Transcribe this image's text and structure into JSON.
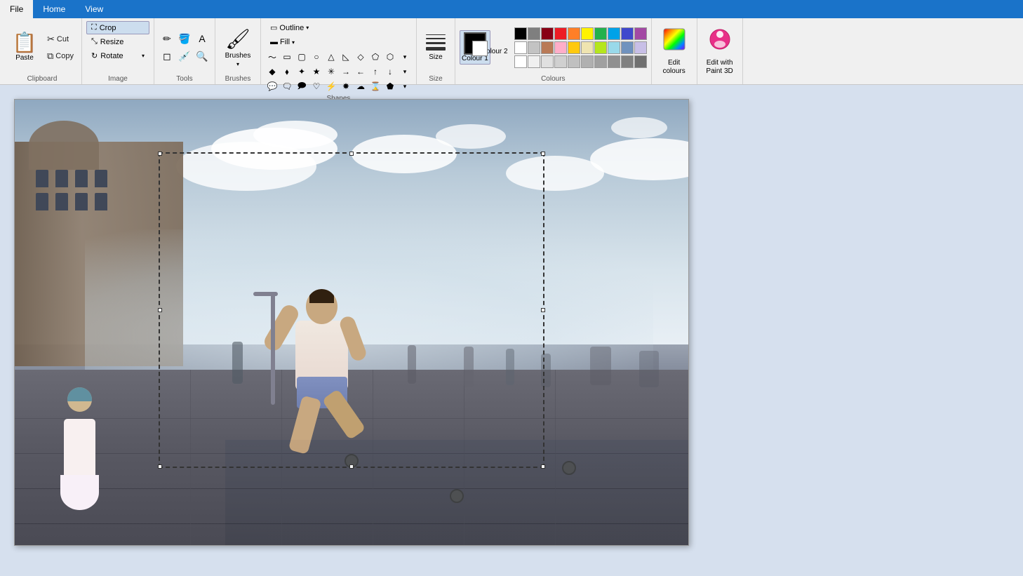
{
  "tabs": {
    "file_label": "File",
    "home_label": "Home",
    "view_label": "View"
  },
  "clipboard": {
    "label": "Clipboard",
    "paste_label": "Paste",
    "cut_label": "Cut",
    "copy_label": "Copy"
  },
  "image": {
    "label": "Image",
    "crop_label": "Crop",
    "resize_label": "Resize",
    "rotate_label": "Rotate"
  },
  "tools": {
    "label": "Tools"
  },
  "brushes": {
    "label": "Brushes"
  },
  "shapes": {
    "label": "Shapes",
    "outline_label": "Outline",
    "fill_label": "Fill"
  },
  "size": {
    "label": "Size"
  },
  "colours": {
    "label": "Colours",
    "colour1_label": "Colour 1",
    "colour2_label": "Colour 2",
    "edit_label": "Edit colours",
    "paint3d_label": "Edit with Paint 3D"
  },
  "color_palette": [
    "#000000",
    "#7f7f7f",
    "#880015",
    "#ed1c24",
    "#ff7f27",
    "#fff200",
    "#22b14c",
    "#00a2e8",
    "#3f48cc",
    "#a349a4",
    "#ffffff",
    "#c3c3c3",
    "#b97a57",
    "#ffaec9",
    "#ffc90e",
    "#efe4b0",
    "#b5e61d",
    "#99d9ea",
    "#7092be",
    "#c8bfe7",
    "#eeeeee",
    "#dddddd",
    "#d0a0a0",
    "#ffffff",
    "#f0f0f0",
    "#e8e8e8",
    "#d0e8d0",
    "#d0e8f0",
    "#d0d0e8",
    "#e8d0e8"
  ]
}
